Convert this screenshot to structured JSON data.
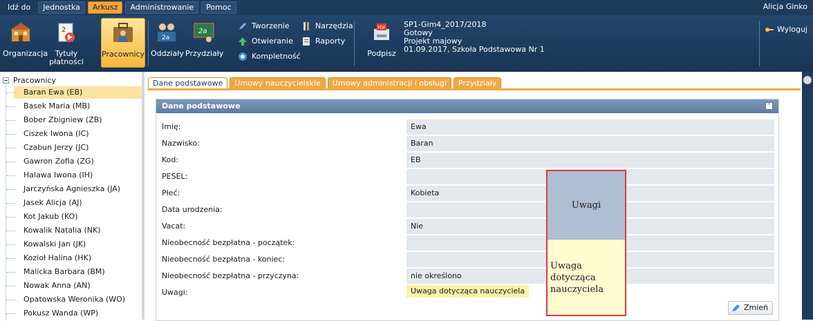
{
  "menu": {
    "items": [
      "Idź do",
      "Jednostka",
      "Arkusz",
      "Administrowanie",
      "Pomoc"
    ],
    "active_index": 2,
    "user": "Alicja Ginko"
  },
  "ribbon": {
    "organizacja": "Organizacja",
    "tytuly": "Tytuły płatności",
    "pracownicy": "Pracownicy",
    "oddzialy": "Oddziały",
    "przydzialy": "Przydziały",
    "tworzenie": "Tworzenie",
    "otwieranie": "Otwieranie",
    "kompletnosc": "Kompletność",
    "narzedzia": "Narzędzia",
    "raporty": "Raporty",
    "podpisz": "Podpisz",
    "doc_line1": "SP1-Gim4_2017/2018",
    "doc_line2": "Gotowy",
    "doc_line3": "Projekt majowy",
    "doc_line4": "01.09.2017, Szkoła Podstawowa Nr 1",
    "wyloguj": "Wyloguj"
  },
  "tree": {
    "root": "Pracownicy",
    "items": [
      "Baran Ewa (EB)",
      "Basek Maria (MB)",
      "Bober Zbigniew (ZB)",
      "Ciszek Iwona (IC)",
      "Czabun Jerzy (JC)",
      "Gawron Zofia (ZG)",
      "Halawa Iwona (IH)",
      "Jarczyńska Agnieszka (JA)",
      "Jasek Alicja (AJ)",
      "Kot Jakub (KO)",
      "Kowalik Natalia (NK)",
      "Kowalski Jan (JK)",
      "Kozioł Halina (HK)",
      "Malicka Barbara (BM)",
      "Nowak Anna (AN)",
      "Opatowska Weronika (WO)",
      "Pokusz Wanda (WP)"
    ],
    "selected_index": 0
  },
  "tabs": [
    "Dane podstawowe",
    "Umowy nauczycielskie",
    "Umowy administracji i obsługi",
    "Przydziały"
  ],
  "panel": {
    "title": "Dane podstawowe",
    "rows": [
      {
        "label": "Imię:",
        "value": "Ewa"
      },
      {
        "label": "Nazwisko:",
        "value": "Baran"
      },
      {
        "label": "Kod:",
        "value": "EB"
      },
      {
        "label": "PESEL:",
        "value": ""
      },
      {
        "label": "Płeć:",
        "value": "Kobieta"
      },
      {
        "label": "Data urodzenia:",
        "value": ""
      },
      {
        "label": "Vacat:",
        "value": "Nie"
      },
      {
        "label": "Nieobecność bezpłatna - początek:",
        "value": ""
      },
      {
        "label": "Nieobecność bezpłatna - koniec:",
        "value": ""
      },
      {
        "label": "Nieobecność bezpłatna - przyczyna:",
        "value": "nie określono"
      },
      {
        "label": "Uwagi:",
        "value": "Uwaga dotycząca nauczyciela"
      }
    ],
    "change_button": "Zmień"
  },
  "callout": {
    "title": "Uwagi",
    "text_line1": "Uwaga",
    "text_line2": "dotycząca",
    "text_line3": "nauczyciela"
  },
  "colors": {
    "menubar": "#1f3b5c",
    "accent": "#f0a844",
    "selected": "#fde3a1",
    "callout_border": "#e0393b"
  }
}
